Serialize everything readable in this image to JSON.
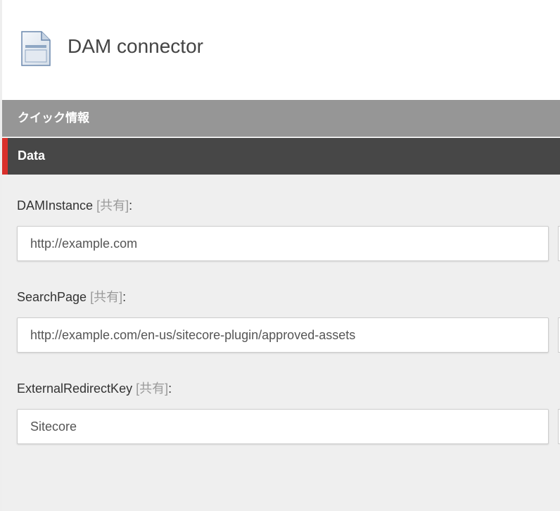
{
  "item": {
    "title": "DAM connector",
    "icon": "document-icon"
  },
  "quick_info": {
    "label": "クイック情報"
  },
  "section": {
    "label": "Data",
    "accent_color": "#d9302b"
  },
  "fields": [
    {
      "label": "DAMInstance",
      "shared": "[共有]",
      "colon": ":",
      "value": "http://example.com"
    },
    {
      "label": "SearchPage",
      "shared": "[共有]",
      "colon": ":",
      "value": "http://example.com/en-us/sitecore-plugin/approved-assets"
    },
    {
      "label": "ExternalRedirectKey",
      "shared": "[共有]",
      "colon": ":",
      "value": "Sitecore"
    }
  ]
}
